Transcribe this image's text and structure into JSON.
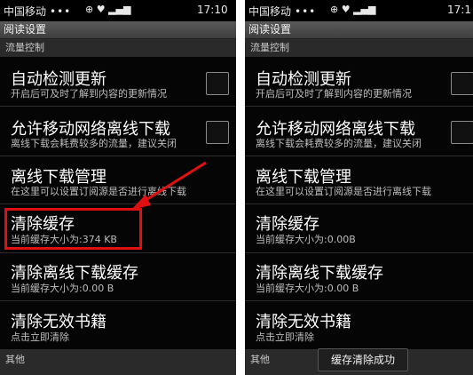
{
  "status_bar": {
    "carrier": "中国移动",
    "dots": "•••",
    "icons": "⊕ ♥ ▂▄▆",
    "time_left": "17:10",
    "time_right": "17:1"
  },
  "title": "阅读设置",
  "sections": {
    "traffic": "流量控制",
    "other": "其他"
  },
  "left": {
    "items": [
      {
        "title": "自动检测更新",
        "subtitle": "开启后可及时了解到内容的更新情况"
      },
      {
        "title": "允许移动网络离线下载",
        "subtitle": "离线下载会耗费较多的流量，建议关闭"
      },
      {
        "title": "离线下载管理",
        "subtitle": "在这里可以设置订阅源是否进行离线下载"
      },
      {
        "title": "清除缓存",
        "subtitle": "当前缓存大小为:374 KB"
      },
      {
        "title": "清除离线下载缓存",
        "subtitle": "当前缓存大小为:0.00 B"
      },
      {
        "title": "清除无效书籍",
        "subtitle": "点击立即清除"
      }
    ]
  },
  "right": {
    "items": [
      {
        "title": "自动检测更新",
        "subtitle": "开启后可及时了解到内容的更新情况"
      },
      {
        "title": "允许移动网络离线下载",
        "subtitle": "离线下载会耗费较多的流量，建议关闭"
      },
      {
        "title": "离线下载管理",
        "subtitle": "在这里可以设置订阅源是否进行离线下载"
      },
      {
        "title": "清除缓存",
        "subtitle": "当前缓存大小为:0.00B"
      },
      {
        "title": "清除离线下载缓存",
        "subtitle": "当前缓存大小为:0.00 B"
      },
      {
        "title": "清除无效书籍",
        "subtitle": "点击立即清除"
      }
    ],
    "toast": "缓存清除成功"
  },
  "colors": {
    "highlight": "#e01010",
    "background": "#050505"
  },
  "icons": [
    "wifi-icon",
    "signal-icon",
    "battery-icon",
    "usb-icon",
    "android-icon"
  ]
}
